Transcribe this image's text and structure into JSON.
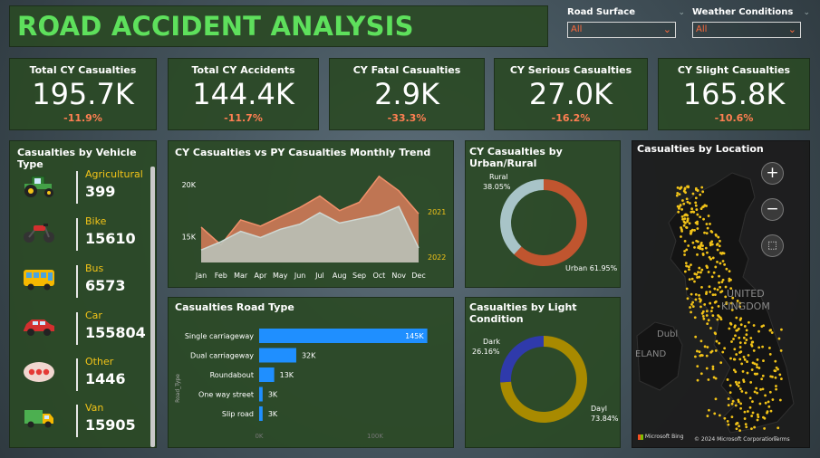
{
  "header": {
    "title": "ROAD ACCIDENT ANALYSIS"
  },
  "slicers": [
    {
      "label": "Road Surface",
      "value": "All"
    },
    {
      "label": "Weather Conditions",
      "value": "All"
    }
  ],
  "kpis": [
    {
      "name": "Total CY Casualties",
      "value": "195.7K",
      "change": "-11.9%"
    },
    {
      "name": "Total CY Accidents",
      "value": "144.4K",
      "change": "-11.7%"
    },
    {
      "name": "CY Fatal Casualties",
      "value": "2.9K",
      "change": "-33.3%"
    },
    {
      "name": "CY Serious Casualties",
      "value": "27.0K",
      "change": "-16.2%"
    },
    {
      "name": "CY Slight Casualties",
      "value": "165.8K",
      "change": "-10.6%"
    }
  ],
  "vehicles": {
    "title": "Casualties by Vehicle Type",
    "items": [
      {
        "name": "Agricultural",
        "value": "399",
        "icon": "tractor-icon"
      },
      {
        "name": "Bike",
        "value": "15610",
        "icon": "motorbike-icon"
      },
      {
        "name": "Bus",
        "value": "6573",
        "icon": "bus-icon"
      },
      {
        "name": "Car",
        "value": "155804",
        "icon": "car-icon"
      },
      {
        "name": "Other",
        "value": "1446",
        "icon": "other-vehicle-icon"
      },
      {
        "name": "Van",
        "value": "15905",
        "icon": "van-icon"
      }
    ]
  },
  "colors": {
    "accent": "#5ee05c",
    "negative": "#ff7f52",
    "cy": "#e8825f",
    "py": "#b9c5bd",
    "urban": "#c0552f",
    "rural": "#a8c4c8",
    "day": "#a88a00",
    "dark": "#2f3aab",
    "bar": "#1f8fff",
    "dot": "#f2c318"
  },
  "chart_data": [
    {
      "type": "area",
      "title": "CY Casualties vs PY Casualties Monthly Trend",
      "categories": [
        "Jan",
        "Feb",
        "Mar",
        "Apr",
        "May",
        "Jun",
        "Jul",
        "Aug",
        "Sep",
        "Oct",
        "Nov",
        "Dec"
      ],
      "ylim": [
        12500,
        22000
      ],
      "ticks": [
        {
          "value": 20000,
          "label": "20K"
        },
        {
          "value": 15000,
          "label": "15K"
        }
      ],
      "series": [
        {
          "name": "2021",
          "values": [
            15900,
            14200,
            16600,
            16000,
            16900,
            17800,
            18900,
            17500,
            18300,
            20800,
            19400,
            17200
          ]
        },
        {
          "name": "2022",
          "values": [
            13700,
            14500,
            15500,
            14900,
            15700,
            16200,
            17300,
            16300,
            16700,
            17100,
            17900,
            13900
          ]
        }
      ]
    },
    {
      "type": "pie",
      "title": "CY Casualties by Urban/Rural",
      "labels": [
        "Urban",
        "Rural"
      ],
      "values": [
        61.95,
        38.05
      ],
      "display": [
        "Urban 61.95%",
        "Rural",
        "38.05%"
      ]
    },
    {
      "type": "bar",
      "title": "Casualties Road Type",
      "ylabel": "Road_Type",
      "categories": [
        "Single carriageway",
        "Dual carriageway",
        "Roundabout",
        "One way street",
        "Slip road"
      ],
      "values": [
        145,
        32,
        13,
        3,
        3
      ],
      "labels": [
        "145K",
        "32K",
        "13K",
        "3K",
        "3K"
      ],
      "xticks": [
        "0K",
        "100K"
      ],
      "xlim": [
        0,
        150
      ]
    },
    {
      "type": "pie",
      "title": "Casualties by Light Condition",
      "labels": [
        "Dayl",
        "Dark"
      ],
      "values": [
        73.84,
        26.16
      ],
      "display": [
        "Dayl",
        "73.84%",
        "Dark",
        "26.16%"
      ]
    }
  ],
  "map": {
    "title": "Casualties by Location",
    "labels": [
      "UNITED",
      "KINGDOM",
      "Dubl",
      "ELAND"
    ],
    "footer": {
      "brand": "Microsoft Bing",
      "copyright": "© 2024 Microsoft Corporation",
      "terms": "Terms"
    },
    "controls": {
      "zoom_in": "+",
      "zoom_out": "−"
    }
  }
}
